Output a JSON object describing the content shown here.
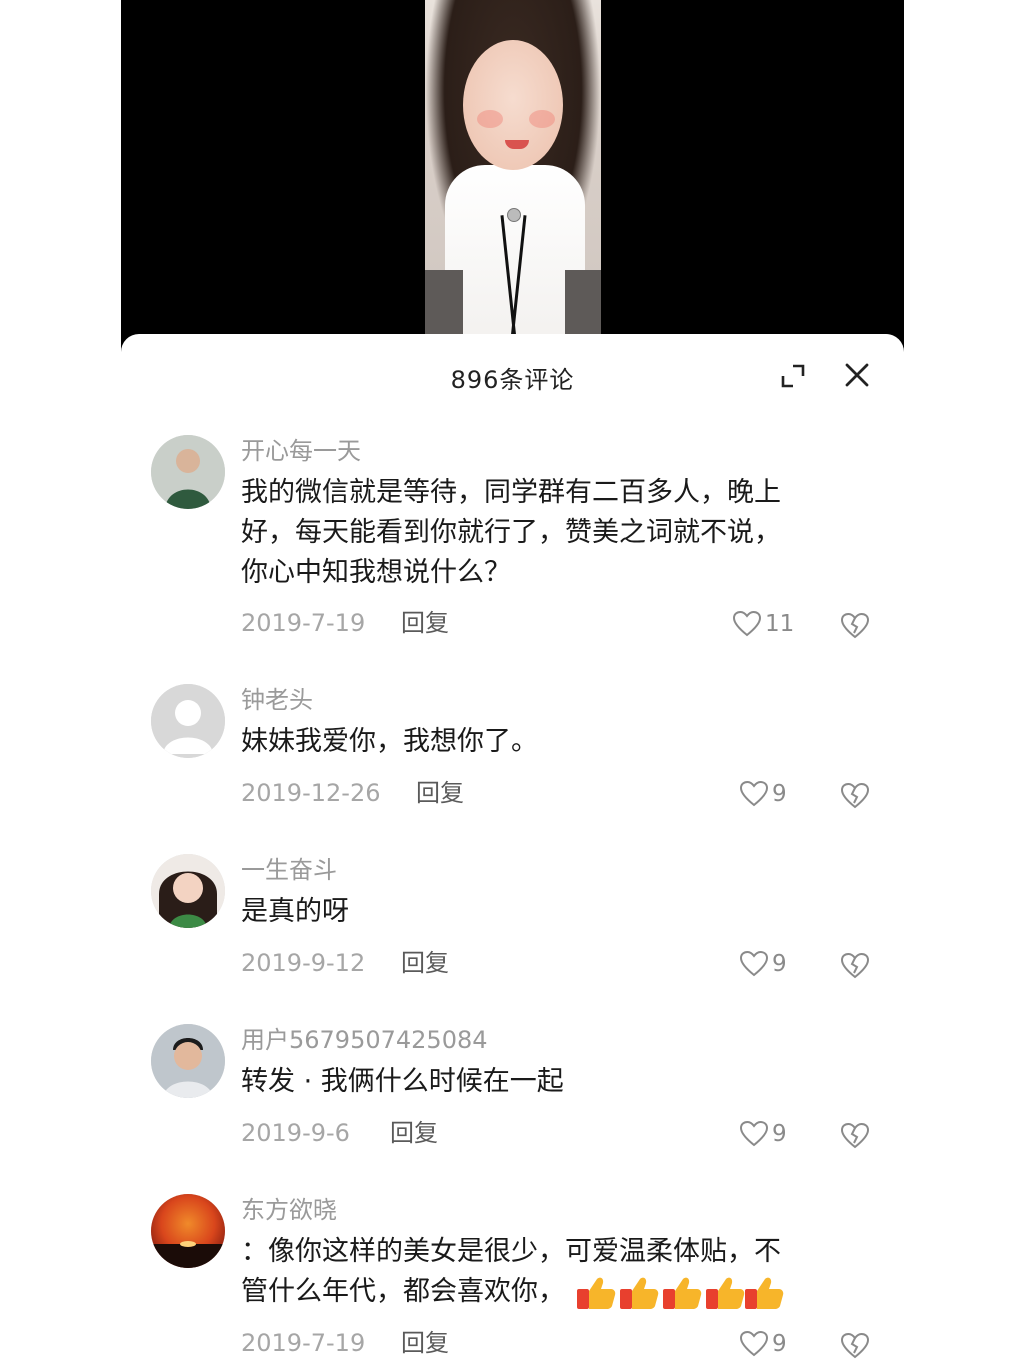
{
  "panel": {
    "title": "896条评论"
  },
  "comments": [
    {
      "user": "开心每一天",
      "text_lines": [
        "我的微信就是等待，同学群有二百多人，晚上",
        "好，每天能看到你就行了，赞美之词就不说，",
        "你心中知我想说什么？"
      ],
      "date": "2019-7-19",
      "reply": "回复",
      "likes": "11"
    },
    {
      "user": "钟老头",
      "text_lines": [
        "妹妹我爱你，我想你了。"
      ],
      "date": "2019-12-26",
      "reply": "回复",
      "likes": "9"
    },
    {
      "user": "一生奋斗",
      "text_lines": [
        "是真的呀"
      ],
      "date": "2019-9-12",
      "reply": "回复",
      "likes": "9"
    },
    {
      "user": "用户5679507425084",
      "text_lines": [
        "转发 · 我俩什么时候在一起"
      ],
      "date": "2019-9-6",
      "reply": "回复",
      "likes": "9"
    },
    {
      "user": "东方欲晓",
      "text_lines": [
        "：像你这样的美女是很少，可爱温柔体贴，不",
        "管什么年代，都会喜欢你，"
      ],
      "date": "2019-7-19",
      "reply": "回复",
      "likes": "9",
      "emoji": "thumbs-up-icon"
    }
  ],
  "colors": {
    "username": "#9a9a9a",
    "text": "#1a1a1a",
    "meta": "#a6a6a6"
  }
}
